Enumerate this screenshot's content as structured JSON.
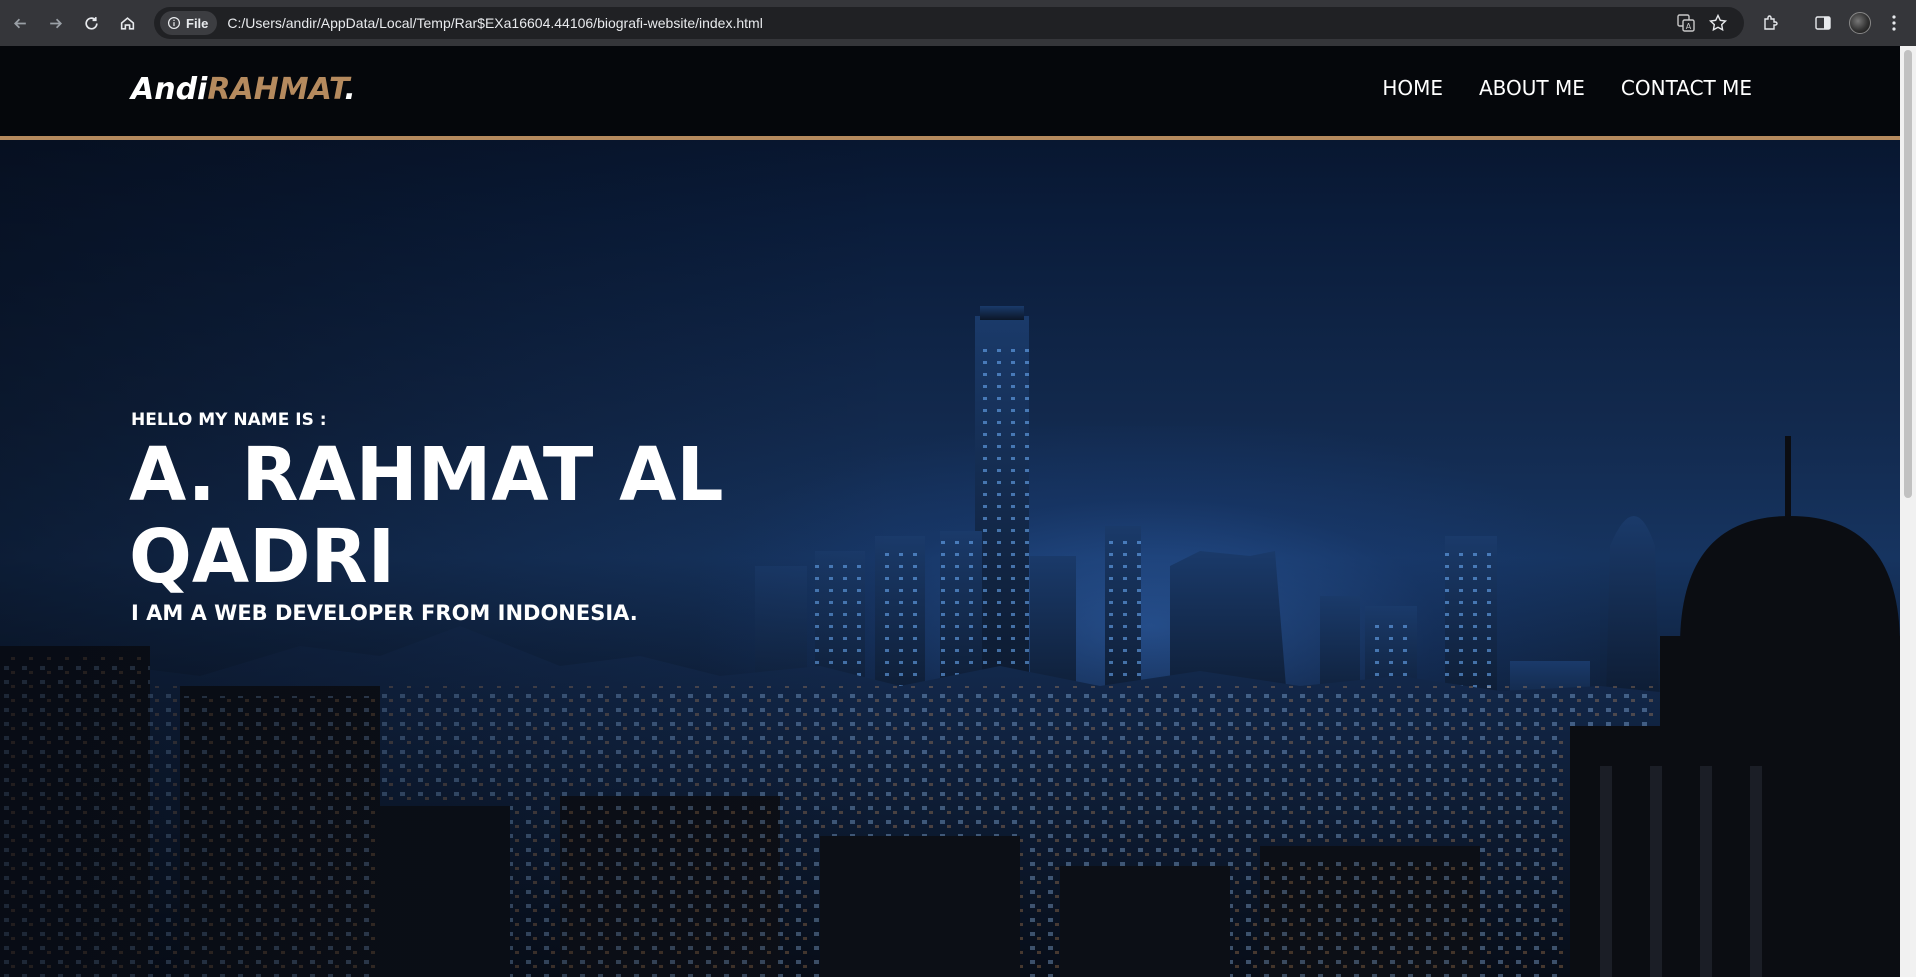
{
  "browser": {
    "address_scheme": "File",
    "url": "C:/Users/andir/AppData/Local/Temp/Rar$EXa16604.44106/biografi-website/index.html",
    "icons": [
      "back-icon",
      "forward-icon",
      "reload-icon",
      "home-icon",
      "info-icon",
      "translate-icon",
      "bookmark-star-icon",
      "extensions-icon",
      "side-panel-icon",
      "profile-avatar",
      "menu-icon"
    ]
  },
  "site": {
    "brand_part1": "Andi",
    "brand_part2": "RAHMAT",
    "brand_part3": ".",
    "nav": [
      {
        "label": "HOME"
      },
      {
        "label": "ABOUT ME"
      },
      {
        "label": "CONTACT ME"
      }
    ],
    "hero": {
      "greeting": "HELLO MY NAME IS :",
      "name": "A. RAHMAT AL QADRI",
      "tagline": "I AM A WEB DEVELOPER FROM INDONESIA."
    }
  },
  "colors": {
    "accent": "#b58a5e",
    "navbar_bg": "#05070b",
    "text": "#ffffff",
    "chrome_bg": "#35363a"
  }
}
